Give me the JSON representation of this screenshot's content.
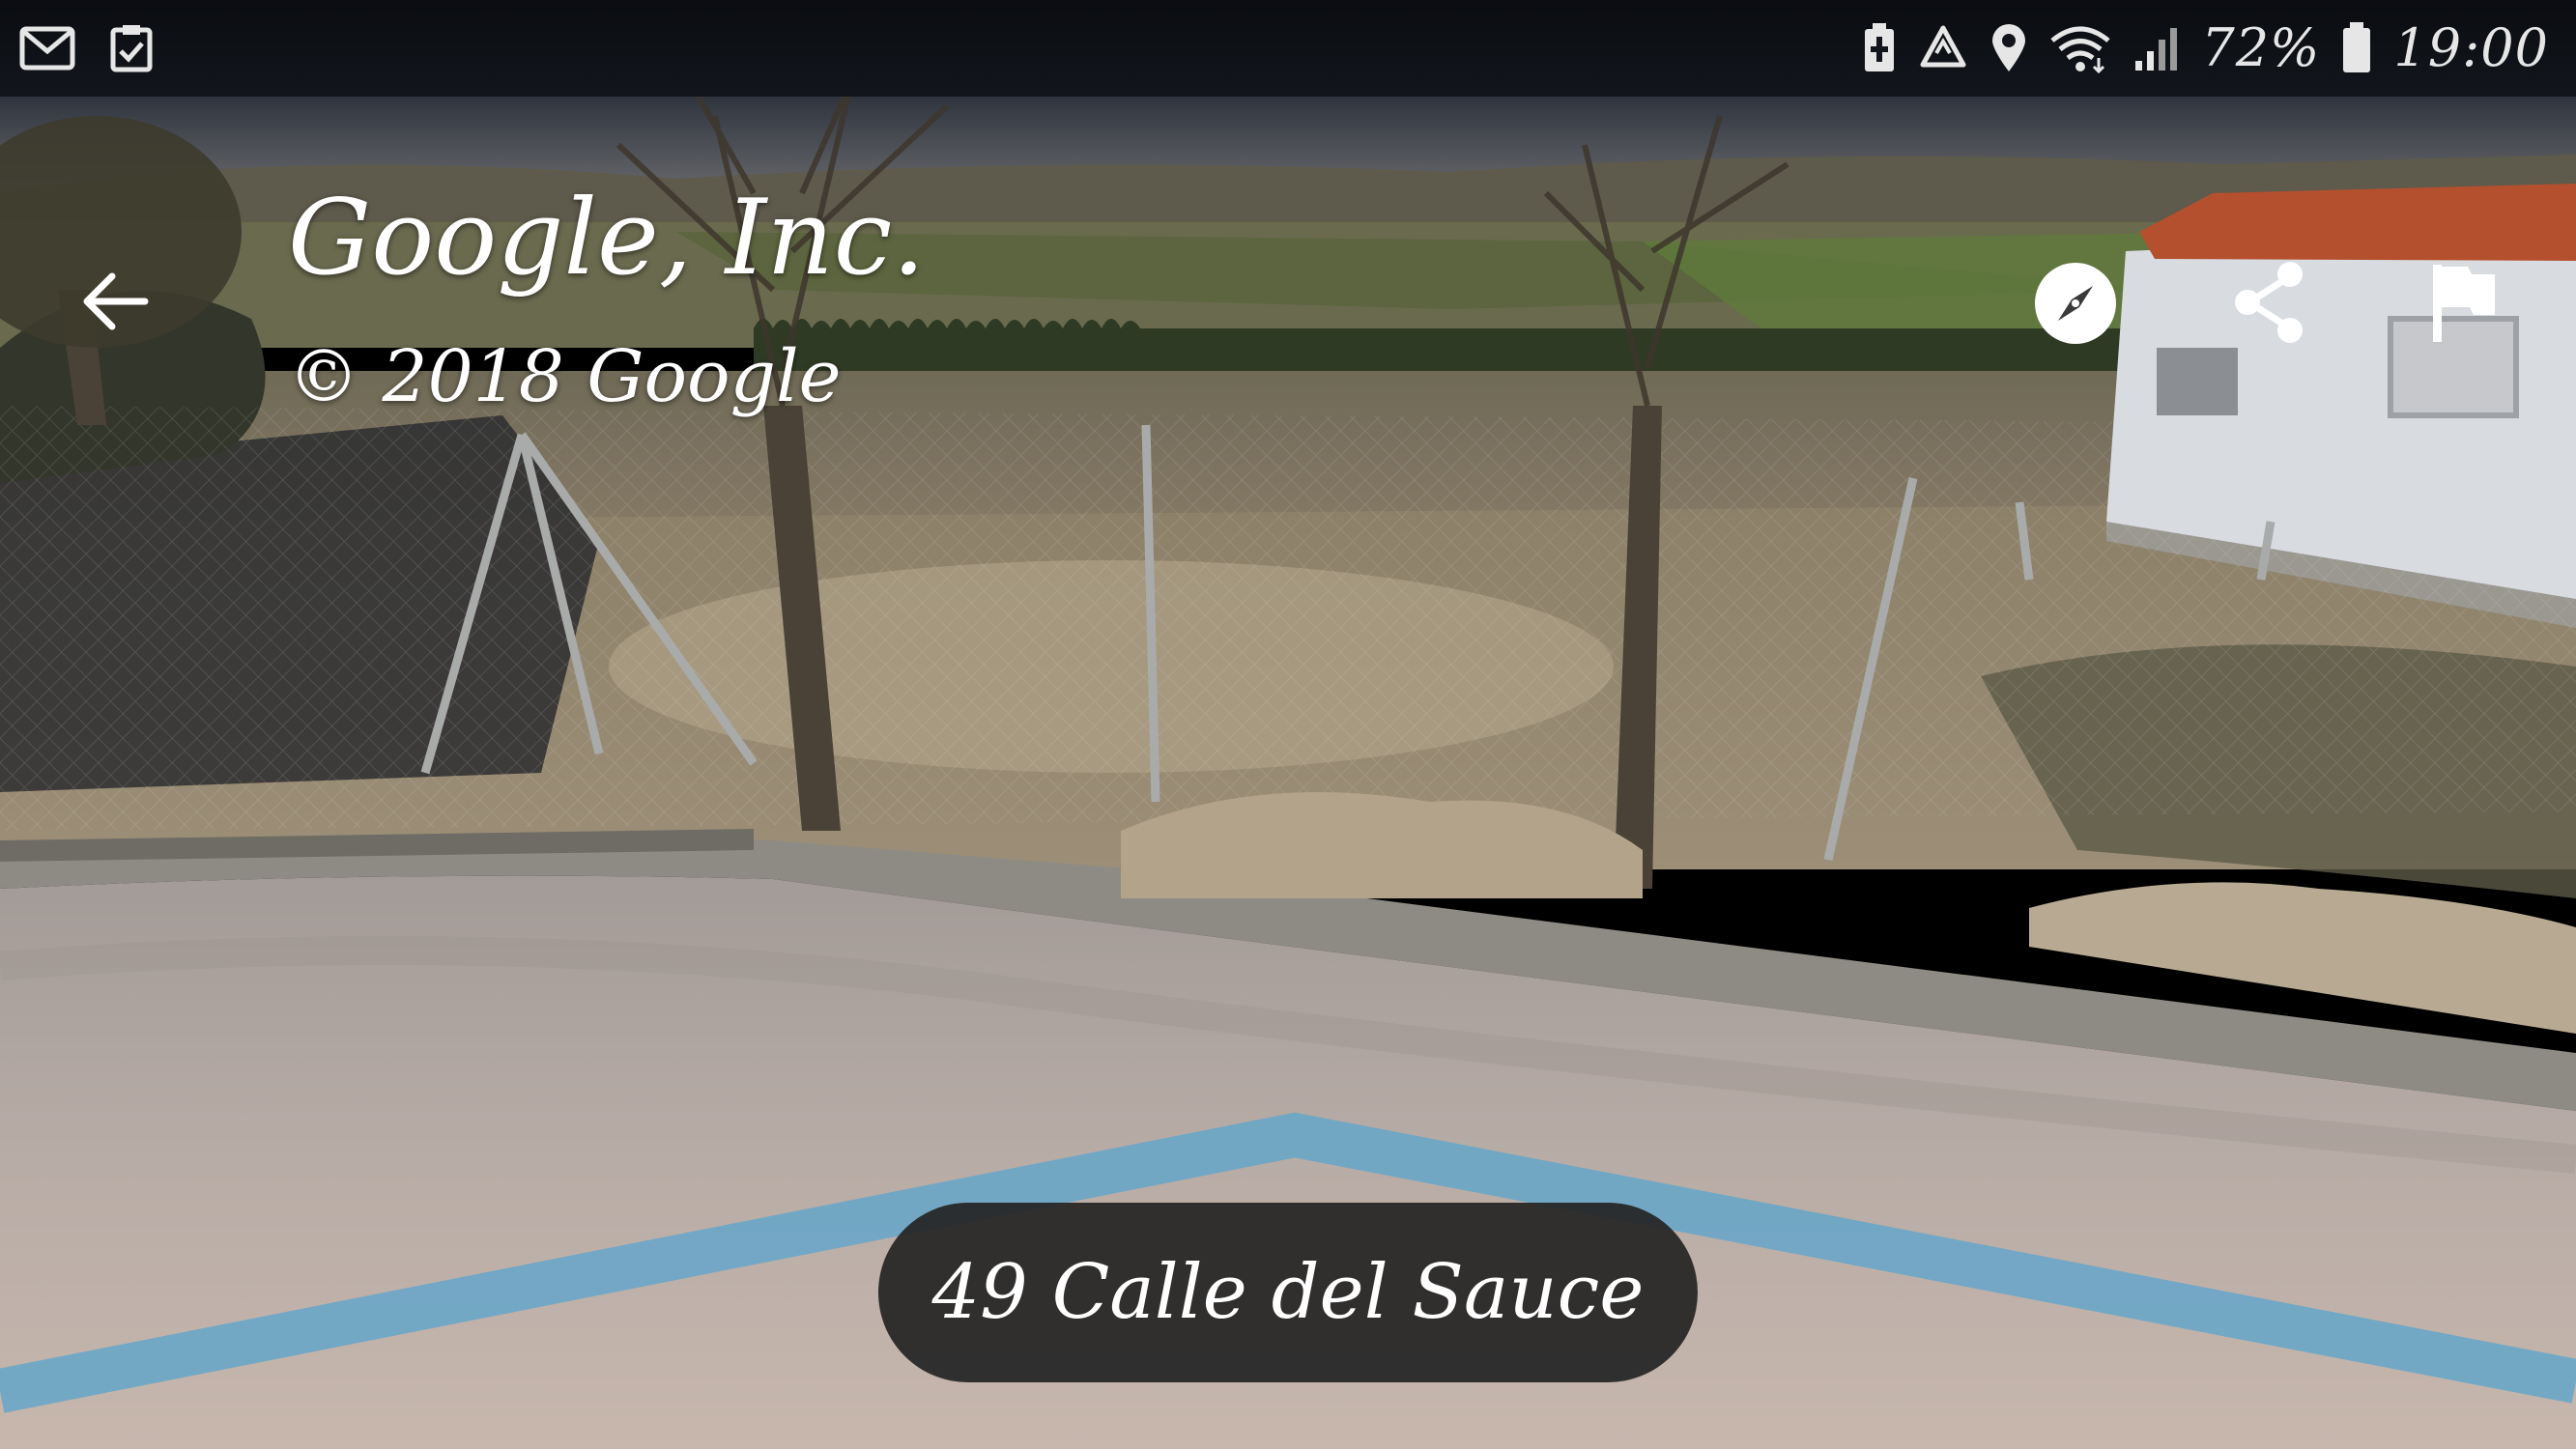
{
  "status_bar": {
    "left_icons": [
      "mail-icon",
      "task-checkbox-icon"
    ],
    "right_icons": [
      "battery-saver-icon",
      "recycle-icon",
      "location-pin-icon",
      "wifi-icon",
      "cell-signal-icon",
      "battery-icon"
    ],
    "battery_percent": "72%",
    "time": "19:00"
  },
  "attribution": {
    "title": "Google, Inc.",
    "copyright": "© 2018 Google"
  },
  "controls": {
    "back_icon": "arrow-left-icon",
    "compass_icon": "compass-icon",
    "share_icon": "share-icon",
    "report_icon": "flag-icon"
  },
  "address": {
    "label": "49 Calle del Sauce"
  },
  "colors": {
    "overlay_text": "#ffffff",
    "pill_background": "#242424",
    "street_marking": "#6aa6c8"
  }
}
